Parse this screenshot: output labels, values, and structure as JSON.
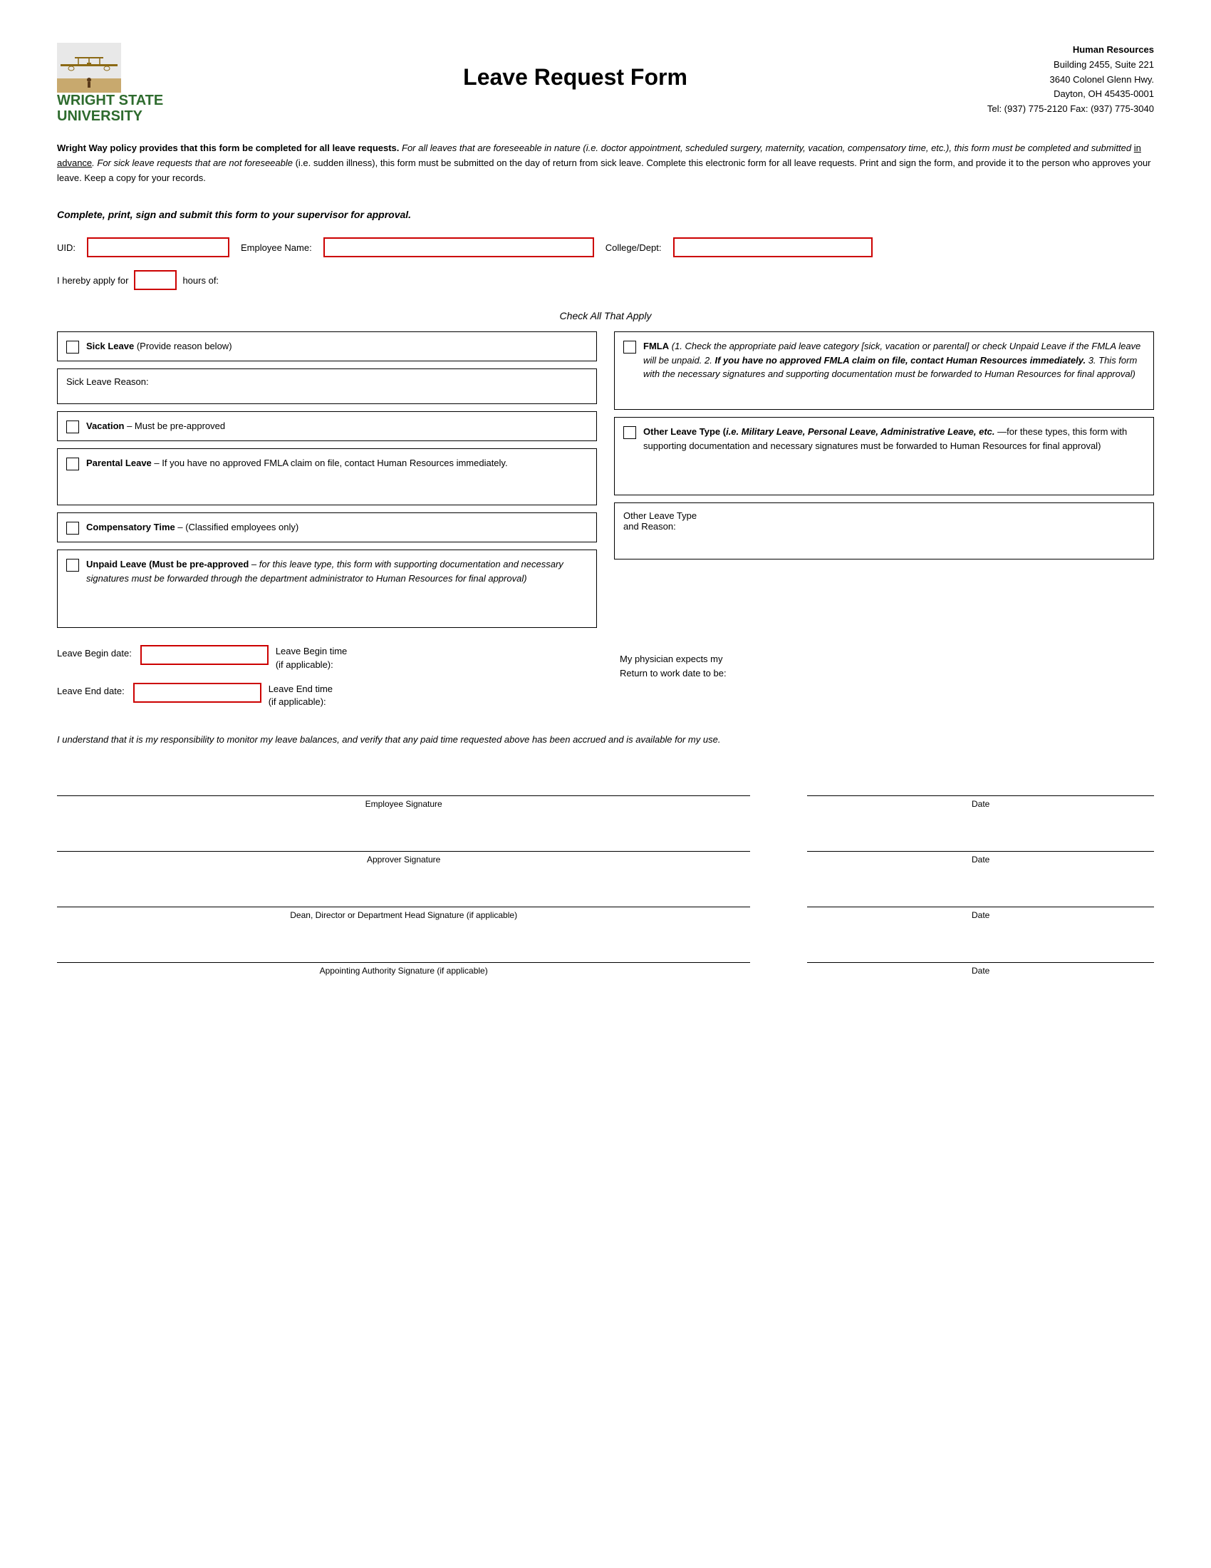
{
  "header": {
    "university_name_line1": "WRIGHT STATE",
    "university_name_line2": "UNIVERSITY",
    "form_title": "Leave Request Form",
    "hr_info": {
      "label": "Human Resources",
      "address1": "Building 2455, Suite 221",
      "address2": "3640 Colonel Glenn Hwy.",
      "address3": "Dayton, OH 45435-0001",
      "contact": "Tel: (937) 775-2120   Fax: (937) 775-3040"
    }
  },
  "policy": {
    "bold_intro": "Wright Way policy provides that this form be completed for all leave requests.",
    "italic_part1": " For all leaves that are foreseeable in nature (i.e. doctor appointment, scheduled surgery, maternity, vacation, compensatory time, etc.), this form must be completed and submitted ",
    "underline_advance": "in advance",
    "italic_part2": ". ",
    "italic_sick": "For sick leave requests that are not foreseeable",
    "regular_end": " (i.e. sudden illness), this form must be submitted on the day of return from sick leave.  Complete this electronic form for all leave requests.  Print and sign the form, and provide it to the person who approves your leave.  Keep a copy for your records."
  },
  "submit_note": "Complete, print, sign and submit this form to your supervisor for approval.",
  "fields": {
    "uid_label": "UID:",
    "empname_label": "Employee Name:",
    "college_label": "College/Dept:",
    "apply_label": "I hereby apply for",
    "hours_label": "hours of:"
  },
  "check_all_label": "Check All That Apply",
  "leave_options": {
    "sick_leave": {
      "label": "Sick Leave",
      "sublabel": "(Provide reason below)"
    },
    "sick_reason": {
      "label": "Sick Leave Reason:"
    },
    "vacation": {
      "label": "Vacation",
      "sublabel": "– Must be pre-approved"
    },
    "parental": {
      "label": "Parental Leave",
      "sublabel": "– If you have no approved FMLA claim on file, contact Human Resources immediately."
    },
    "compensatory": {
      "label": "Compensatory Time",
      "sublabel": "– (Classified employees only)"
    },
    "unpaid": {
      "label": "Unpaid Leave (Must be pre-approved",
      "sublabel": "– for this leave type, this form with supporting documentation and necessary signatures must be forwarded through the department administrator to Human Resources for final approval)"
    },
    "fmla": {
      "bold_label": "FMLA",
      "text": "(1. Check the appropriate paid leave category [sick, vacation or parental] or check Unpaid Leave if the FMLA leave will be unpaid.  2. ",
      "bold_text2": "If you have no approved FMLA claim on file, contact Human Resources immediately.",
      "text2": "  3. This form with the necessary signatures and supporting documentation must be forwarded to Human Resources for final approval)"
    },
    "other_leave_type": {
      "bold_label": "Other Leave Type",
      "text": "(",
      "italic_label": "i.e. Military Leave, Personal Leave, Administrative Leave, etc.",
      "text2": "—for these types, this form with supporting documentation and necessary signatures must be forwarded to Human Resources for final approval)"
    },
    "other_reason_label": "Other Leave Type\nand Reason:"
  },
  "dates": {
    "begin_label": "Leave Begin date:",
    "begin_time_label": "Leave Begin time\n(if applicable):",
    "end_label": "Leave End date:",
    "end_time_label": "Leave End time\n(if applicable):",
    "physician_text": "My physician expects my\nReturn to work date to be:"
  },
  "responsibility_text": "I understand that it is my responsibility to monitor my leave balances, and verify that any paid time requested above has been accrued and is available for my use.",
  "signatures": [
    {
      "label": "Employee Signature",
      "date_label": "Date"
    },
    {
      "label": "Approver Signature",
      "date_label": "Date"
    },
    {
      "label": "Dean, Director or Department Head Signature (if applicable)",
      "date_label": "Date"
    },
    {
      "label": "Appointing Authority Signature (if applicable)",
      "date_label": "Date"
    }
  ]
}
